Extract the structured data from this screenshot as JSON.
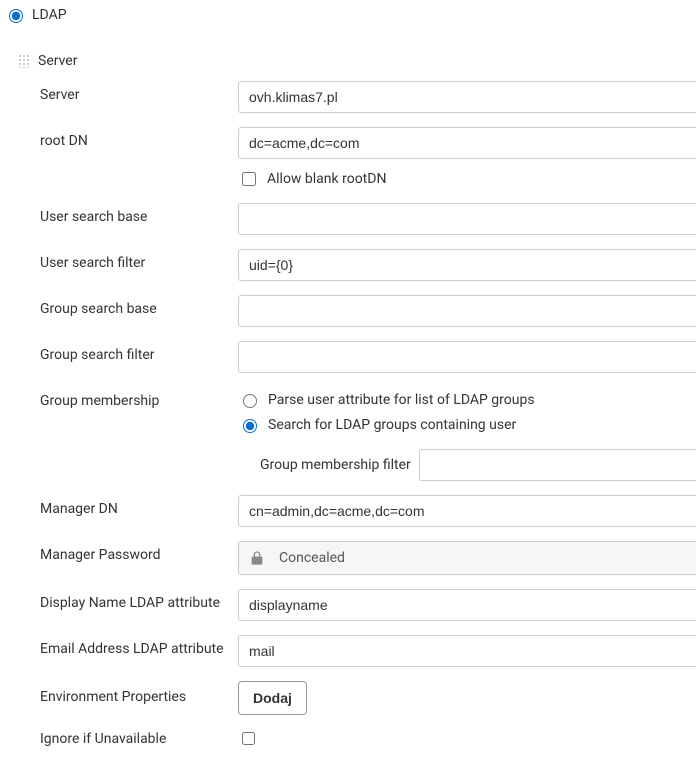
{
  "top": {
    "ldap_label": "LDAP"
  },
  "section": {
    "title": "Server"
  },
  "labels": {
    "server": "Server",
    "root_dn": "root DN",
    "allow_blank_root_dn": "Allow blank rootDN",
    "user_search_base": "User search base",
    "user_search_filter": "User search filter",
    "group_search_base": "Group search base",
    "group_search_filter": "Group search filter",
    "group_membership": "Group membership",
    "gm_parse": "Parse user attribute for list of LDAP groups",
    "gm_search": "Search for LDAP groups containing user",
    "gm_filter": "Group membership filter",
    "manager_dn": "Manager DN",
    "manager_password": "Manager Password",
    "concealed": "Concealed",
    "display_name_attr": "Display Name LDAP attribute",
    "email_attr": "Email Address LDAP attribute",
    "env_props": "Environment Properties",
    "add_button": "Dodaj",
    "ignore_if_unavailable": "Ignore if Unavailable"
  },
  "values": {
    "server": "ovh.klimas7.pl",
    "root_dn": "dc=acme,dc=com",
    "user_search_base": "",
    "user_search_filter": "uid={0}",
    "group_search_base": "",
    "group_search_filter": "",
    "gm_filter": "",
    "manager_dn": "cn=admin,dc=acme,dc=com",
    "display_name_attr": "displayname",
    "email_attr": "mail"
  }
}
